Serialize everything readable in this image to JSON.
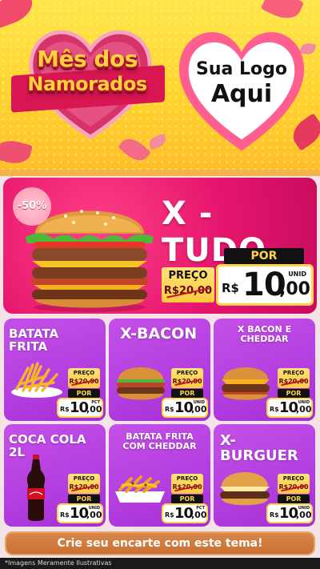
{
  "header": {
    "title_line1": "Mês dos",
    "title_line2": "Namorados",
    "logo_line1": "Sua Logo",
    "logo_line2": "Aqui"
  },
  "featured": {
    "name": "X - TUDO",
    "discount_badge": "-50%",
    "price_label": "PREÇO",
    "old_price": "R$20,00",
    "por_label": "POR",
    "currency": "R$",
    "price_int": "10",
    "price_dec": ",00",
    "unit": "UNID"
  },
  "products": [
    {
      "name": "BATATA FRITA",
      "price_label": "PREÇO",
      "old_price": "R$20,00",
      "por_label": "POR",
      "currency": "R$",
      "price_int": "10",
      "price_dec": ",00",
      "unit": "PCT"
    },
    {
      "name": "X-BACON",
      "price_label": "PREÇO",
      "old_price": "R$20,00",
      "por_label": "POR",
      "currency": "R$",
      "price_int": "10",
      "price_dec": ",00",
      "unit": "UNID"
    },
    {
      "name": "X BACON E CHEDDAR",
      "price_label": "PREÇO",
      "old_price": "R$20,00",
      "por_label": "POR",
      "currency": "R$",
      "price_int": "10",
      "price_dec": ",00",
      "unit": "UNID"
    },
    {
      "name": "COCA COLA 2L",
      "price_label": "PREÇO",
      "old_price": "R$20,00",
      "por_label": "POR",
      "currency": "R$",
      "price_int": "10",
      "price_dec": ",00",
      "unit": "UNID"
    },
    {
      "name": "BATATA FRITA COM CHEDDAR",
      "price_label": "PREÇO",
      "old_price": "R$20,00",
      "por_label": "POR",
      "currency": "R$",
      "price_int": "10",
      "price_dec": ",00",
      "unit": "PCT"
    },
    {
      "name": "X-BURGUER",
      "price_label": "PREÇO",
      "old_price": "R$20,00",
      "por_label": "POR",
      "currency": "R$",
      "price_int": "10",
      "price_dec": ",00",
      "unit": "UNID"
    }
  ],
  "cta": {
    "label": "Crie seu encarte com este tema!"
  },
  "footer": {
    "disclaimer": "*Imagens Meramente Ilustrativas"
  },
  "colors": {
    "header_yellow": "#ffd22e",
    "featured_pink": "#e5156d",
    "card_purple": "#b43de0",
    "price_gold": "#ffd44b",
    "cta_orange": "#c77235"
  },
  "icons": [
    "heart-logo-frame",
    "heart-title-frame",
    "rose-petal",
    "burger-image",
    "fries-image",
    "soda-bottle-image"
  ]
}
